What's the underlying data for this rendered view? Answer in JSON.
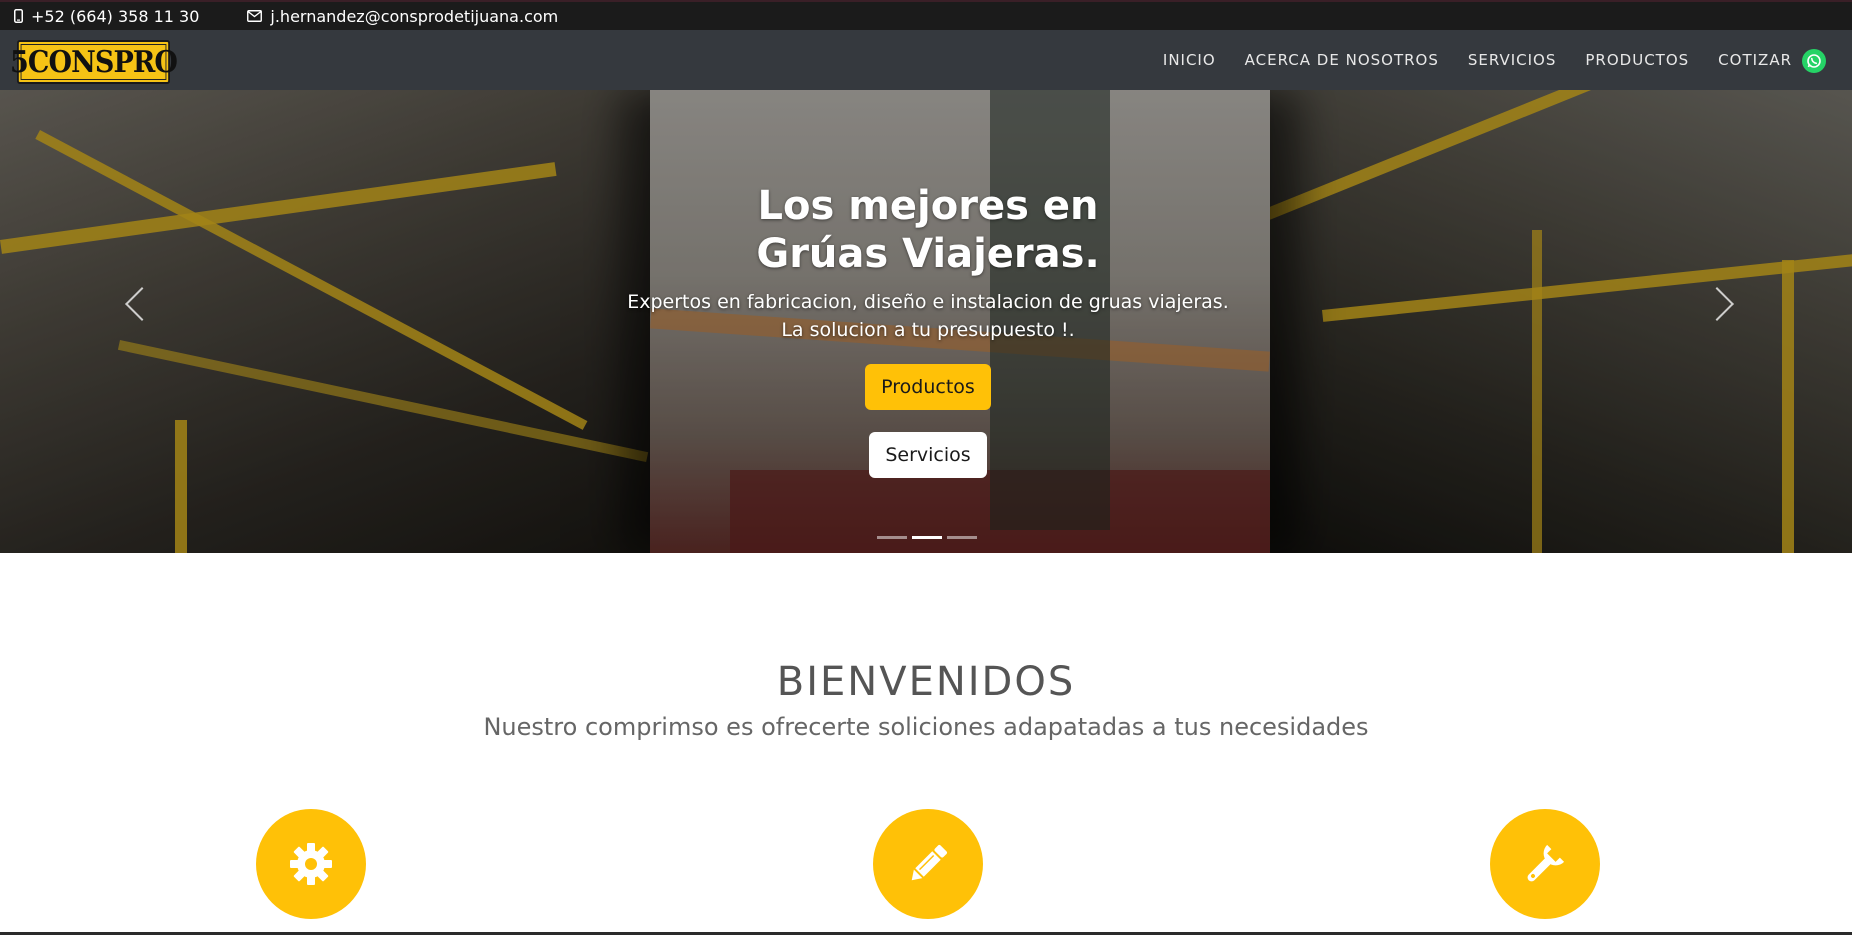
{
  "topbar": {
    "phone": "+52 (664) 358 11 30",
    "email": "j.hernandez@consprodetijuana.com",
    "phone_icon": "phone-icon",
    "email_icon": "envelope-icon"
  },
  "nav": {
    "logo_text": "5CONSPRO",
    "items": [
      {
        "label": "INICIO"
      },
      {
        "label": "ACERCA DE NOSOTROS"
      },
      {
        "label": "SERVICIOS"
      },
      {
        "label": "PRODUCTOS"
      },
      {
        "label": "COTIZAR"
      }
    ],
    "whatsapp_icon": "whatsapp-icon"
  },
  "hero": {
    "title_line1": "Los mejores en",
    "title_line2": "Grúas Viajeras.",
    "text_line1": "Expertos en fabricacion, diseño e instalacion de gruas viajeras.",
    "text_line2": "La solucion a tu presupuesto !.",
    "primary_button": "Productos",
    "secondary_button": "Servicios",
    "slide_count": 3,
    "active_slide": 2
  },
  "welcome": {
    "title": "BIENVENIDOS",
    "subtitle": "Nuestro comprimso es ofrecerte soliciones adapatadas a tus necesidades",
    "features": [
      {
        "icon": "gear-icon"
      },
      {
        "icon": "pencil-icon"
      },
      {
        "icon": "wrench-icon"
      }
    ]
  },
  "colors": {
    "accent": "#ffc107",
    "nav_bg": "#35393e",
    "topbar_bg": "#1b1b1b",
    "whatsapp": "#25d366"
  }
}
